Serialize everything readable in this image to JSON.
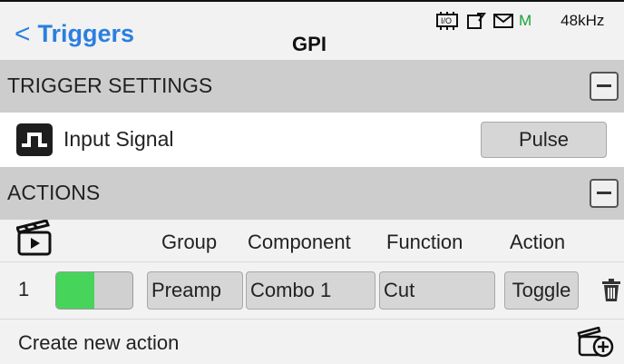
{
  "header": {
    "back_label": "Triggers",
    "title": "GPI",
    "status": {
      "mode": "M",
      "sample_rate": "48kHz"
    }
  },
  "trigger_settings": {
    "heading": "TRIGGER SETTINGS",
    "input_signal": {
      "label": "Input Signal",
      "value": "Pulse"
    }
  },
  "actions": {
    "heading": "ACTIONS",
    "columns": [
      "Group",
      "Component",
      "Function",
      "Action"
    ],
    "rows": [
      {
        "index": "1",
        "enabled": true,
        "group": "Preamp",
        "component": "Combo 1",
        "function": "Cut",
        "action": "Toggle"
      }
    ],
    "create_label": "Create new action"
  },
  "colors": {
    "accent": "#2a7fe0",
    "toggle_on": "#46d45a",
    "section_bg": "#cdcdcd",
    "mode_green": "#1aa23a"
  },
  "icons": [
    "chevron-left-icon",
    "io-chip-icon",
    "edit-icon",
    "mail-icon",
    "collapse-minus-icon",
    "pulse-signal-icon",
    "clapperboard-icon",
    "trash-icon",
    "add-action-icon"
  ]
}
